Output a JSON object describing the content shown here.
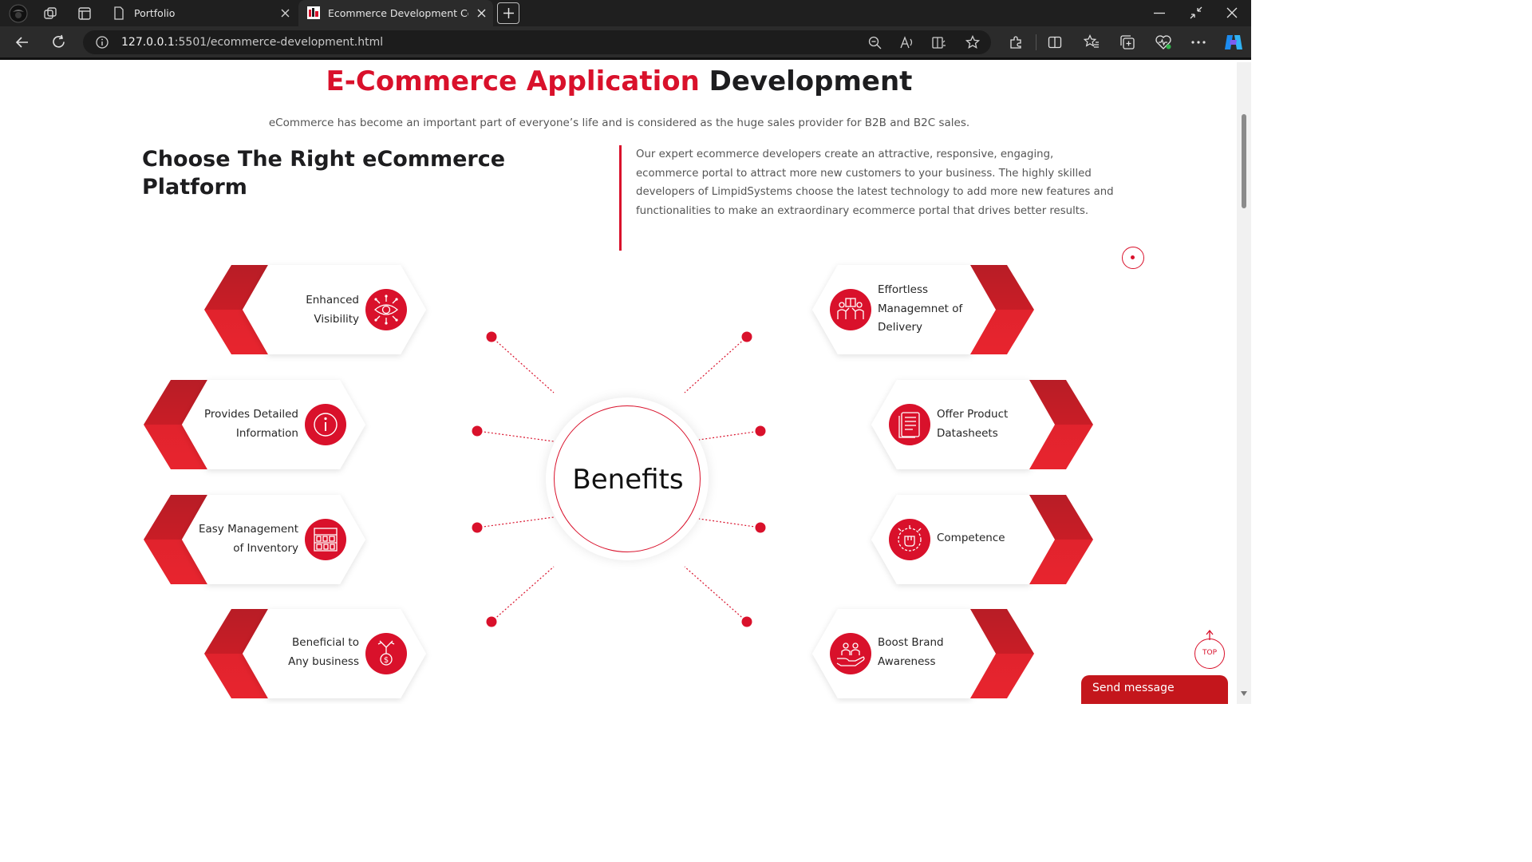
{
  "browser": {
    "tabs": [
      {
        "title": "Portfolio",
        "active": false
      },
      {
        "title": "Ecommerce Development Comp",
        "active": true
      }
    ],
    "url": {
      "host": "127.0.0.1",
      "rest": ":5501/ecommerce-development.html"
    }
  },
  "page": {
    "heading_red": "E-Commerce Application",
    "heading_dark": " Development",
    "lead": "eCommerce has become an important part of everyone’s life and is considered as the huge sales provider for B2B and B2C sales.",
    "choose_heading": "Choose The Right eCommerce Platform",
    "intro": "Our expert ecommerce developers create an attractive, responsive, engaging, ecommerce portal to attract more new customers to your business. The highly skilled developers of LimpidSystems choose the latest technology to add more new features and functionalities to make an extraordinary ecommerce portal that drives better results.",
    "center_label": "Benefits",
    "benefits_left": [
      {
        "label": "Enhanced Visibility",
        "icon": "eye-network-icon"
      },
      {
        "label": "Provides Detailed Information",
        "icon": "info-icon"
      },
      {
        "label": "Easy Management of Inventory",
        "icon": "inventory-shelf-icon"
      },
      {
        "label": "Beneficial to Any business",
        "icon": "dollar-growth-icon"
      }
    ],
    "benefits_right": [
      {
        "label": "Effortless Managemnet of Delivery",
        "icon": "delivery-people-icon"
      },
      {
        "label": "Offer Product Datasheets",
        "icon": "datasheet-icon"
      },
      {
        "label": "Competence",
        "icon": "fist-competence-icon"
      },
      {
        "label": "Boost Brand Awareness",
        "icon": "hand-people-icon"
      }
    ],
    "top_button": "TOP",
    "send_message": "Send message"
  },
  "colors": {
    "accent": "#d9112b",
    "dark_text": "#1d1d1f"
  }
}
